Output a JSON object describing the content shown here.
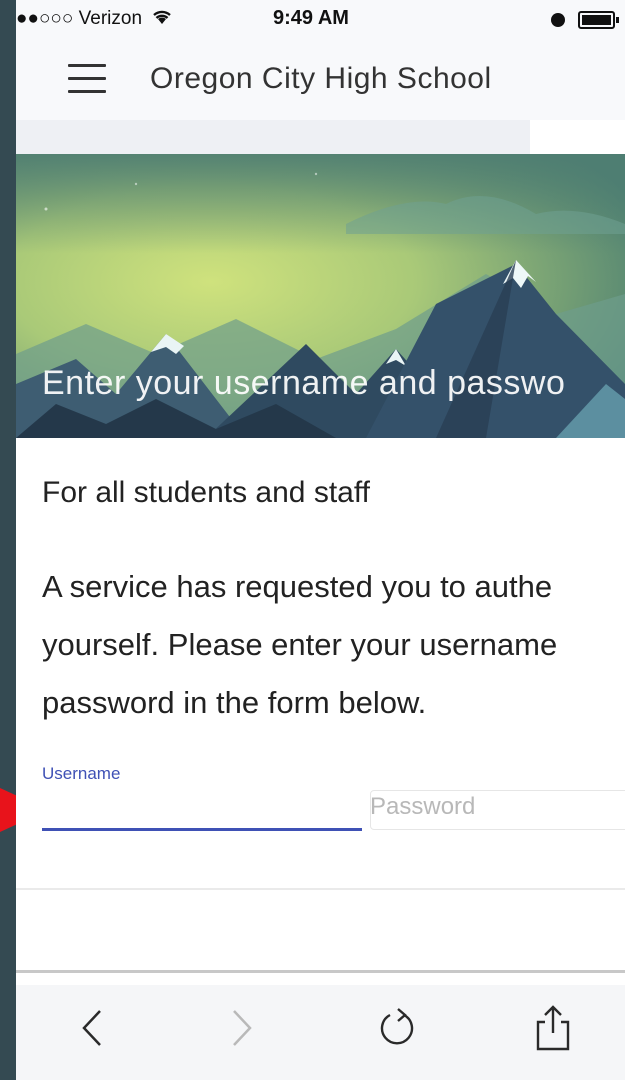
{
  "status_bar": {
    "carrier": "●●○○○ Verizon",
    "time": "9:49 AM"
  },
  "header": {
    "title": "Oregon City High School"
  },
  "hero": {
    "text": "Enter your username and passwo"
  },
  "content": {
    "subtitle": "For all students and staff",
    "description": "A service has requested you to authe\nyourself. Please enter your username\npassword in the form below."
  },
  "form": {
    "username_label": "Username",
    "username_value": "",
    "password_placeholder": "Password"
  },
  "colors": {
    "accent": "#3f51b5",
    "hero_sky_top": "#5e8f7e",
    "hero_sky_glow": "#c6dd7a",
    "pointer": "#e8131b"
  },
  "icons": {
    "menu": "hamburger-icon",
    "wifi": "wifi-icon",
    "alarm": "alarm-icon",
    "battery": "battery-icon",
    "back": "chevron-left-icon",
    "forward": "chevron-right-icon",
    "reload": "reload-icon",
    "share": "share-icon"
  }
}
